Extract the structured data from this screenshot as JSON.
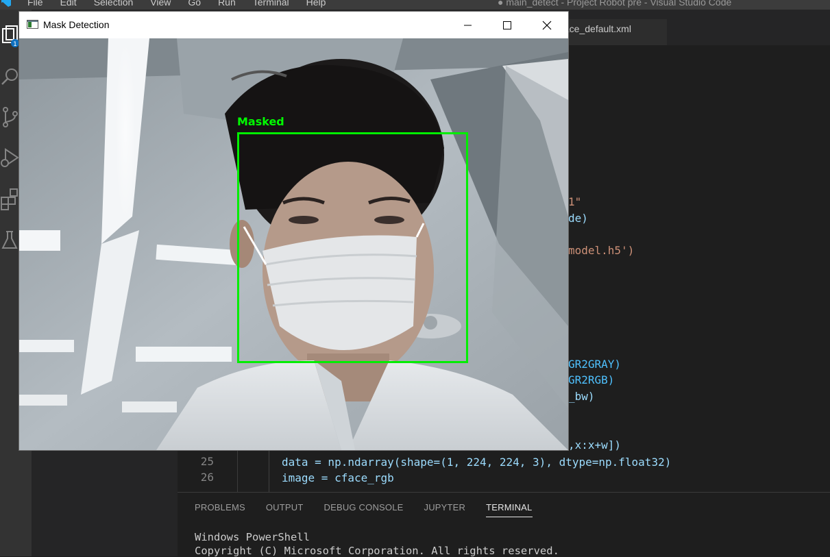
{
  "vscode": {
    "menu": [
      "File",
      "Edit",
      "Selection",
      "View",
      "Go",
      "Run",
      "Terminal",
      "Help"
    ],
    "window_title": "● main_detect - Project Robot pre - Visual Studio Code",
    "tab_label": "face_default.xml",
    "code_fragments": [
      {
        "text": "1\"",
        "color": "#ce9178"
      },
      {
        "text": "de)",
        "color": "#9cdcfe"
      },
      {
        "text": "model.h5')",
        "color": "#ce9178"
      },
      {
        "text": "GR2GRAY)",
        "color": "#4fc1ff"
      },
      {
        "text": "GR2RGB)",
        "color": "#4fc1ff"
      },
      {
        "text": "_bw)",
        "color": "#9cdcfe"
      },
      {
        "text": ",x:x+w])",
        "color": "#9cdcfe"
      }
    ],
    "line_numbers": [
      "25",
      "26"
    ],
    "code_line_25": "data = np.ndarray(shape=(1, 224, 224, 3), dtype=np.float32)",
    "code_line_26": "image = cface_rgb",
    "panel_tabs": [
      "PROBLEMS",
      "OUTPUT",
      "DEBUG CONSOLE",
      "JUPYTER",
      "TERMINAL"
    ],
    "active_panel_tab": "TERMINAL",
    "terminal_lines": [
      "Windows PowerShell",
      "Copyright (C) Microsoft Corporation. All rights reserved."
    ]
  },
  "mask_window": {
    "title": "Mask Detection",
    "detection_label": "Masked",
    "box_color": "#00ee00"
  },
  "icons": {
    "window_controls": [
      "minimize-icon",
      "maximize-icon",
      "close-icon"
    ],
    "activity_bar": [
      "explorer-icon",
      "search-icon",
      "source-control-icon",
      "run-debug-icon",
      "extensions-icon",
      "testing-icon"
    ]
  }
}
